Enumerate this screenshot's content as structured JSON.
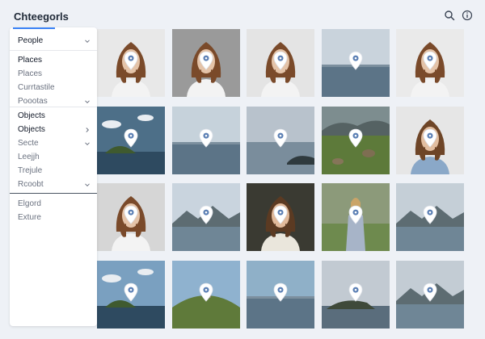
{
  "header": {
    "title": "Chteegorls",
    "search_icon": "search-icon",
    "info_icon": "info-icon"
  },
  "sidebar": {
    "items": [
      {
        "label": "People",
        "chevron": "down",
        "strong": true
      },
      {
        "label": "Places",
        "chevron": "",
        "strong": true
      },
      {
        "label": "Places",
        "chevron": "",
        "strong": false
      },
      {
        "label": "Currtastile",
        "chevron": "",
        "strong": false
      },
      {
        "label": "Poootas",
        "chevron": "down",
        "strong": false
      },
      {
        "label": "Objects",
        "chevron": "",
        "strong": true
      },
      {
        "label": "Objects",
        "chevron": "right",
        "strong": true
      },
      {
        "label": "Secte",
        "chevron": "down",
        "strong": false
      },
      {
        "label": "Leejjh",
        "chevron": "",
        "strong": false
      },
      {
        "label": "Trejule",
        "chevron": "",
        "strong": false
      },
      {
        "label": "Rcoobt",
        "chevron": "down",
        "strong": false
      },
      {
        "label": "Elgord",
        "chevron": "",
        "strong": false
      },
      {
        "label": "Exture",
        "chevron": "",
        "strong": false
      }
    ]
  },
  "grid": {
    "tiles": [
      {
        "kind": "portrait",
        "bg": "#e8e8e8",
        "pin": "map-pin-icon"
      },
      {
        "kind": "portrait",
        "bg": "#9a9a9a",
        "pin": "map-pin-icon"
      },
      {
        "kind": "portrait",
        "bg": "#e4e4e4",
        "pin": "map-pin-icon"
      },
      {
        "kind": "sea",
        "bg": "#c9d3dc",
        "pin": "map-pin-icon"
      },
      {
        "kind": "portrait",
        "bg": "#eaeaea",
        "pin": "map-pin-icon"
      },
      {
        "kind": "island",
        "bg": "#4d6f88",
        "pin": "map-pin-icon"
      },
      {
        "kind": "sea",
        "bg": "#c6d2db",
        "pin": "map-pin-icon"
      },
      {
        "kind": "coast",
        "bg": "#b8c2cc",
        "pin": "map-pin-icon"
      },
      {
        "kind": "hills",
        "bg": "#7d8d8f",
        "pin": "map-pin-icon"
      },
      {
        "kind": "portrait-blue",
        "bg": "#e6e6e6",
        "pin": "map-pin-icon"
      },
      {
        "kind": "portrait",
        "bg": "#d6d6d6",
        "pin": "map-pin-icon"
      },
      {
        "kind": "mountain",
        "bg": "#c9d4de",
        "pin": "map-pin-icon"
      },
      {
        "kind": "portrait-dark",
        "bg": "#3a3a32",
        "pin": "map-pin-icon"
      },
      {
        "kind": "standing",
        "bg": "#8c9a7a",
        "pin": "map-pin-icon"
      },
      {
        "kind": "mountain",
        "bg": "#c5cfd7",
        "pin": "map-pin-icon"
      },
      {
        "kind": "island",
        "bg": "#7aa0c0",
        "pin": "map-pin-icon"
      },
      {
        "kind": "grass",
        "bg": "#8fb2cf",
        "pin": "map-pin-icon"
      },
      {
        "kind": "sea",
        "bg": "#8fb0c8",
        "pin": "map-pin-icon"
      },
      {
        "kind": "rock",
        "bg": "#c2cad2",
        "pin": "map-pin-icon"
      },
      {
        "kind": "mountain",
        "bg": "#c3ccd4",
        "pin": "map-pin-icon"
      }
    ]
  }
}
